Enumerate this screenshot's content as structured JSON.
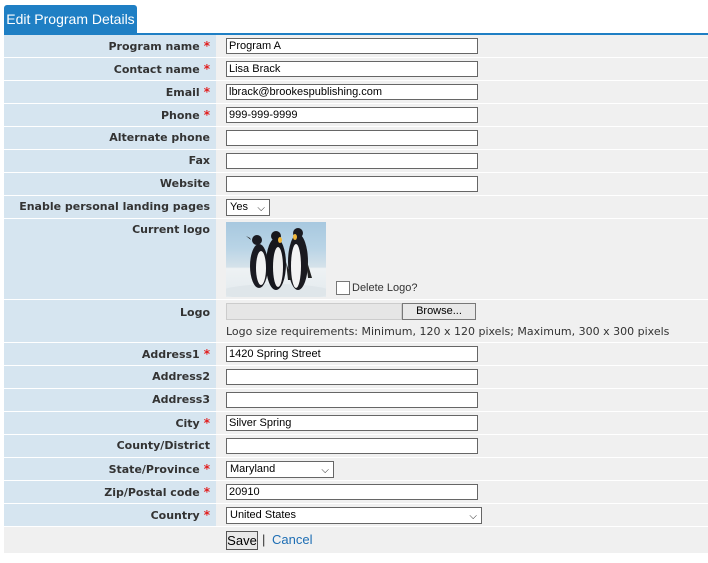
{
  "tab": {
    "label": "Edit Program Details"
  },
  "fields": {
    "program_name": {
      "label": "Program name",
      "value": "Program A",
      "required": true
    },
    "contact_name": {
      "label": "Contact name",
      "value": "Lisa Brack",
      "required": true
    },
    "email": {
      "label": "Email",
      "value": "lbrack@brookespublishing.com",
      "required": true
    },
    "phone": {
      "label": "Phone",
      "value": "999-999-9999",
      "required": true
    },
    "alt_phone": {
      "label": "Alternate phone",
      "value": ""
    },
    "fax": {
      "label": "Fax",
      "value": ""
    },
    "website": {
      "label": "Website",
      "value": ""
    },
    "landing_pages": {
      "label": "Enable personal landing pages",
      "value": "Yes"
    },
    "current_logo": {
      "label": "Current logo",
      "delete_label": "Delete Logo?"
    },
    "logo": {
      "label": "Logo",
      "browse_label": "Browse...",
      "note": "Logo size requirements: Minimum, 120 x 120 pixels; Maximum, 300 x 300 pixels"
    },
    "address1": {
      "label": "Address1",
      "value": "1420 Spring Street",
      "required": true
    },
    "address2": {
      "label": "Address2",
      "value": ""
    },
    "address3": {
      "label": "Address3",
      "value": ""
    },
    "city": {
      "label": "City",
      "value": "Silver Spring",
      "required": true
    },
    "county": {
      "label": "County/District",
      "value": ""
    },
    "state": {
      "label": "State/Province",
      "value": "Maryland",
      "required": true
    },
    "zip": {
      "label": "Zip/Postal code",
      "value": "20910",
      "required": true
    },
    "country": {
      "label": "Country",
      "value": "United States",
      "required": true
    }
  },
  "required_marker": "*",
  "actions": {
    "save_label": "Save",
    "separator": "|",
    "cancel_label": "Cancel"
  },
  "colors": {
    "accent": "#1f7fc4",
    "label_bg": "#d6e5f0",
    "value_bg": "#f0f0f0",
    "required": "#e11d1d",
    "link": "#1e6eb4"
  }
}
